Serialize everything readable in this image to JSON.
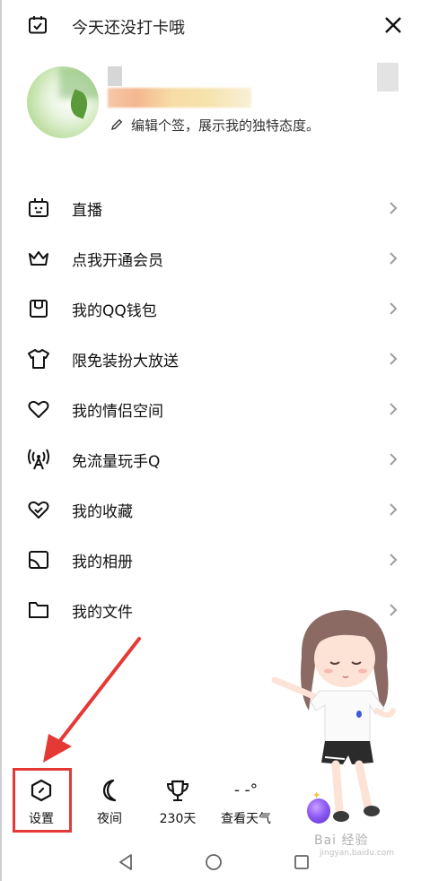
{
  "header": {
    "checkin_text": "今天还没打卡哦",
    "checkin_icon": "calendar-check-icon",
    "close_icon": "close-icon"
  },
  "profile": {
    "signature": "编辑个签，展示我的独特态度。",
    "edit_icon": "pencil-icon"
  },
  "menu": {
    "items": [
      {
        "label": "直播",
        "icon": "live-tv-icon"
      },
      {
        "label": "点我开通会员",
        "icon": "crown-icon"
      },
      {
        "label": "我的QQ钱包",
        "icon": "wallet-icon"
      },
      {
        "label": "限免装扮大放送",
        "icon": "tshirt-icon"
      },
      {
        "label": "我的情侣空间",
        "icon": "heart-icon"
      },
      {
        "label": "免流量玩手Q",
        "icon": "antenna-icon"
      },
      {
        "label": "我的收藏",
        "icon": "favorite-heart-icon"
      },
      {
        "label": "我的相册",
        "icon": "photo-album-icon"
      },
      {
        "label": "我的文件",
        "icon": "folder-icon"
      }
    ]
  },
  "bottom_tools": {
    "settings": "设置",
    "night": "夜间",
    "days": "230天",
    "weather_temp": "- -°",
    "weather": "查看天气"
  },
  "watermark": {
    "brand": "Bai 经验",
    "url": "jingyan.baidu.com"
  },
  "colors": {
    "highlight": "#e53935",
    "text": "#111111",
    "chevron": "#9e9e9e"
  }
}
